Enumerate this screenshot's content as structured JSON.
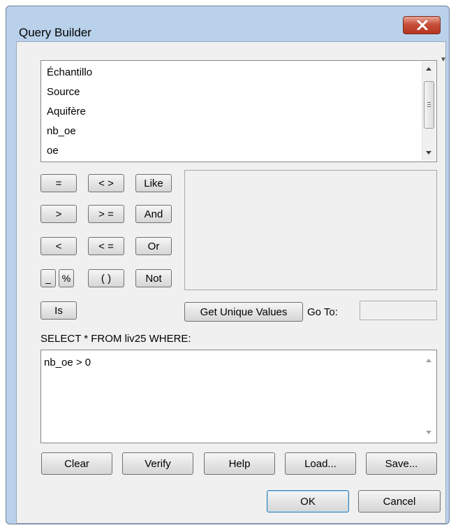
{
  "window": {
    "title": "Query Builder"
  },
  "fields": [
    "Échantillo",
    "Source",
    "Aquifère",
    "nb_oe",
    "oe"
  ],
  "operators": {
    "eq": "=",
    "neq": "< >",
    "like": "Like",
    "gt": ">",
    "gte": "> =",
    "and": "And",
    "lt": "<",
    "lte": "< =",
    "or": "Or",
    "underscore": "_",
    "percent": "%",
    "parens": "( )",
    "not": "Not",
    "is": "Is"
  },
  "values": {
    "get_unique_label": "Get Unique Values",
    "goto_label": "Go To:",
    "goto_value": ""
  },
  "sql": {
    "prefix": "SELECT * FROM liv25 WHERE:",
    "expression": "nb_oe > 0"
  },
  "actions": {
    "clear": "Clear",
    "verify": "Verify",
    "help": "Help",
    "load": "Load...",
    "save": "Save..."
  },
  "dialog": {
    "ok": "OK",
    "cancel": "Cancel"
  },
  "icons": {
    "close": "close-icon",
    "scroll_up": "scroll-up-arrow-icon",
    "scroll_down": "scroll-down-arrow-icon"
  },
  "colors": {
    "title_bar": "#b9d1ea",
    "close_button": "#c7503b",
    "face": "#f0f0f0"
  }
}
